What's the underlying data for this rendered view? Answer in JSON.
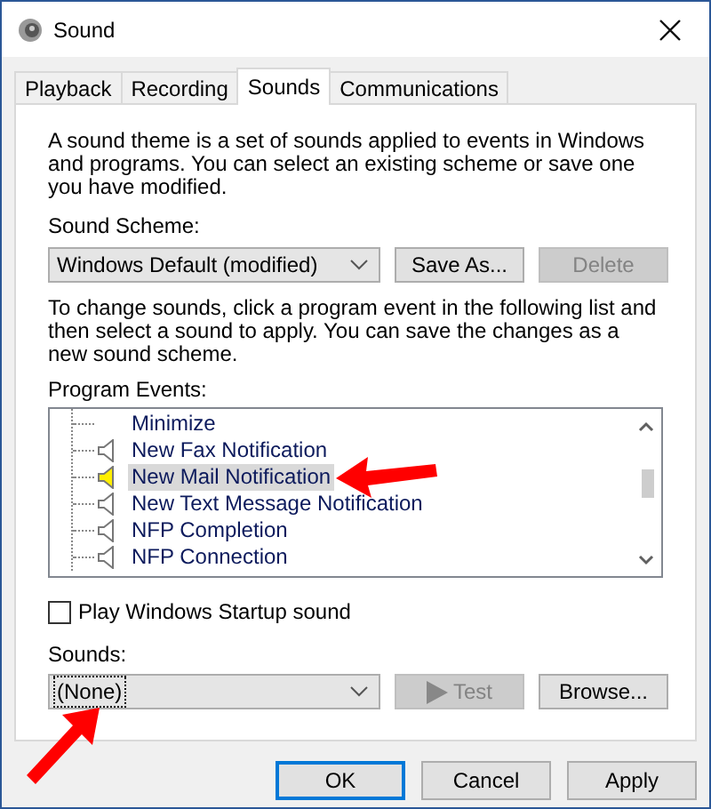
{
  "window": {
    "title": "Sound"
  },
  "tabs": [
    {
      "label": "Playback",
      "selected": false
    },
    {
      "label": "Recording",
      "selected": false
    },
    {
      "label": "Sounds",
      "selected": true
    },
    {
      "label": "Communications",
      "selected": false
    }
  ],
  "description": "A sound theme is a set of sounds applied to events in Windows and programs.  You can select an existing scheme or save one you have modified.",
  "scheme_label": "Sound Scheme:",
  "scheme": {
    "value": "Windows Default (modified)"
  },
  "scheme_buttons": [
    {
      "label": "Save As...",
      "disabled": false
    },
    {
      "label": "Delete",
      "disabled": true
    }
  ],
  "instructions": "To change sounds, click a program event in the following list and then select a sound to apply.  You can save the changes as a new sound scheme.",
  "events_label": "Program Events:",
  "events": [
    {
      "label": "Minimize",
      "kind": "plain",
      "selected": false
    },
    {
      "label": "New Fax Notification",
      "kind": "sound",
      "selected": false
    },
    {
      "label": "New Mail Notification",
      "kind": "sound",
      "selected": true
    },
    {
      "label": "New Text Message Notification",
      "kind": "sound",
      "selected": false
    },
    {
      "label": "NFP Completion",
      "kind": "sound",
      "selected": false
    },
    {
      "label": "NFP Connection",
      "kind": "sound",
      "selected": false
    }
  ],
  "startup": {
    "label": "Play Windows Startup sound",
    "checked": false
  },
  "sounds_label": "Sounds:",
  "sound": {
    "value": "(None)"
  },
  "sound_buttons": [
    {
      "label": "Test",
      "kind": "play",
      "disabled": true
    },
    {
      "label": "Browse...",
      "kind": "plain",
      "disabled": false
    }
  ],
  "dialog_buttons": [
    {
      "label": "OK",
      "default": true
    },
    {
      "label": "Cancel",
      "default": false
    },
    {
      "label": "Apply",
      "default": false
    }
  ]
}
